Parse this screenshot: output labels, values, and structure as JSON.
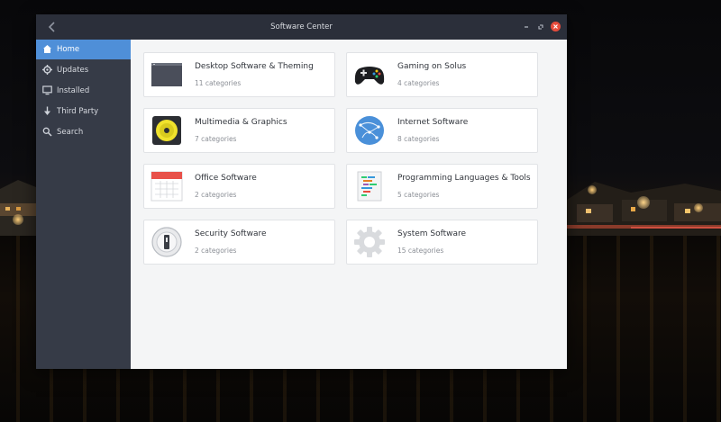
{
  "window": {
    "title": "Software Center"
  },
  "sidebar": {
    "items": [
      {
        "label": "Home",
        "icon": "home-icon",
        "active": true
      },
      {
        "label": "Updates",
        "icon": "updates-icon",
        "active": false
      },
      {
        "label": "Installed",
        "icon": "monitor-icon",
        "active": false
      },
      {
        "label": "Third Party",
        "icon": "download-arrow-icon",
        "active": false
      },
      {
        "label": "Search",
        "icon": "search-icon",
        "active": false
      }
    ]
  },
  "categories": [
    {
      "title": "Desktop Software & Theming",
      "subtitle": "11 categories",
      "icon": "desktop-window-icon"
    },
    {
      "title": "Gaming on Solus",
      "subtitle": "4 categories",
      "icon": "gamepad-icon"
    },
    {
      "title": "Multimedia & Graphics",
      "subtitle": "7 categories",
      "icon": "speaker-icon"
    },
    {
      "title": "Internet Software",
      "subtitle": "8 categories",
      "icon": "globe-icon"
    },
    {
      "title": "Office Software",
      "subtitle": "2 categories",
      "icon": "calendar-icon"
    },
    {
      "title": "Programming Languages & Tools",
      "subtitle": "5 categories",
      "icon": "code-document-icon"
    },
    {
      "title": "Security Software",
      "subtitle": "2 categories",
      "icon": "lock-icon"
    },
    {
      "title": "System Software",
      "subtitle": "15 categories",
      "icon": "gear-icon"
    }
  ],
  "colors": {
    "accent": "#4f8fd8",
    "sidebar": "#363b47",
    "titlebar": "#2b2f3a",
    "close": "#e74c3c"
  }
}
